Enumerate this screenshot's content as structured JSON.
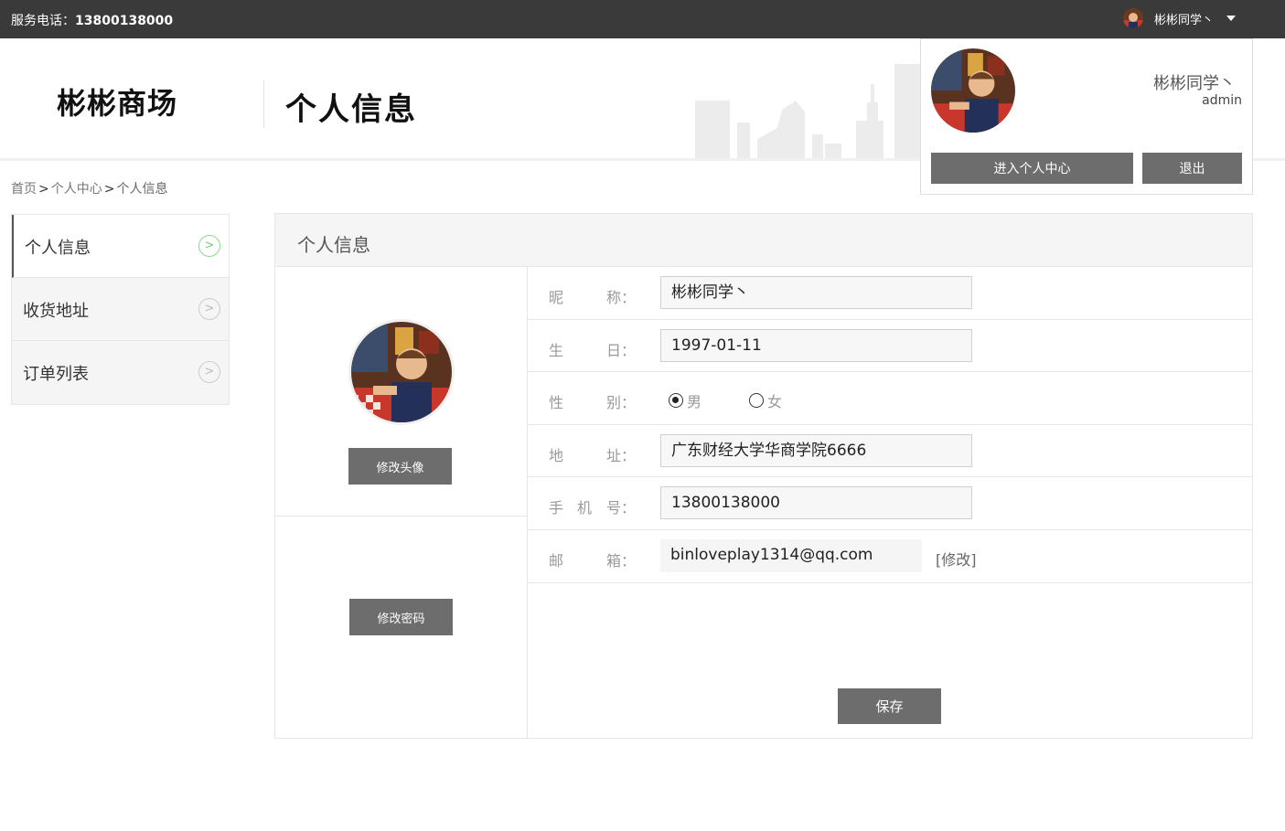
{
  "topbar": {
    "phone_label": "服务电话：",
    "phone": "13800138000",
    "username": "彬彬同学丶"
  },
  "header": {
    "logo": "彬彬商场",
    "page_heading": "个人信息"
  },
  "breadcrumb": {
    "home": "首页",
    "center": "个人中心",
    "current": "个人信息",
    "sep": ">"
  },
  "sidebar": {
    "items": [
      {
        "label": "个人信息",
        "active": true
      },
      {
        "label": "收货地址",
        "active": false
      },
      {
        "label": "订单列表",
        "active": false
      }
    ]
  },
  "panel": {
    "title": "个人信息",
    "change_avatar": "修改头像",
    "change_password": "修改密码",
    "save": "保存"
  },
  "form": {
    "nickname": {
      "k1": "昵",
      "k2": "称：",
      "value": "彬彬同学丶"
    },
    "birthday": {
      "k1": "生",
      "k2": "日：",
      "value": "1997-01-11"
    },
    "gender": {
      "k1": "性",
      "k2": "别：",
      "male": "男",
      "female": "女",
      "selected": "男"
    },
    "address": {
      "k1": "地",
      "k2": "址：",
      "value": "广东财经大学华商学院6666"
    },
    "phone": {
      "k1": "手",
      "k3": "机",
      "k2": "号：",
      "value": "13800138000"
    },
    "email": {
      "k1": "邮",
      "k2": "箱：",
      "value": "binloveplay1314@qq.com",
      "modify": "[修改]"
    }
  },
  "dropdown": {
    "name": "彬彬同学丶",
    "role": "admin",
    "center_button": "进入个人中心",
    "logout_button": "退出"
  },
  "colors": {
    "topbar": "#3a3a3a",
    "button": "#6d6d6d",
    "active_arrow": "#7ac97a"
  }
}
